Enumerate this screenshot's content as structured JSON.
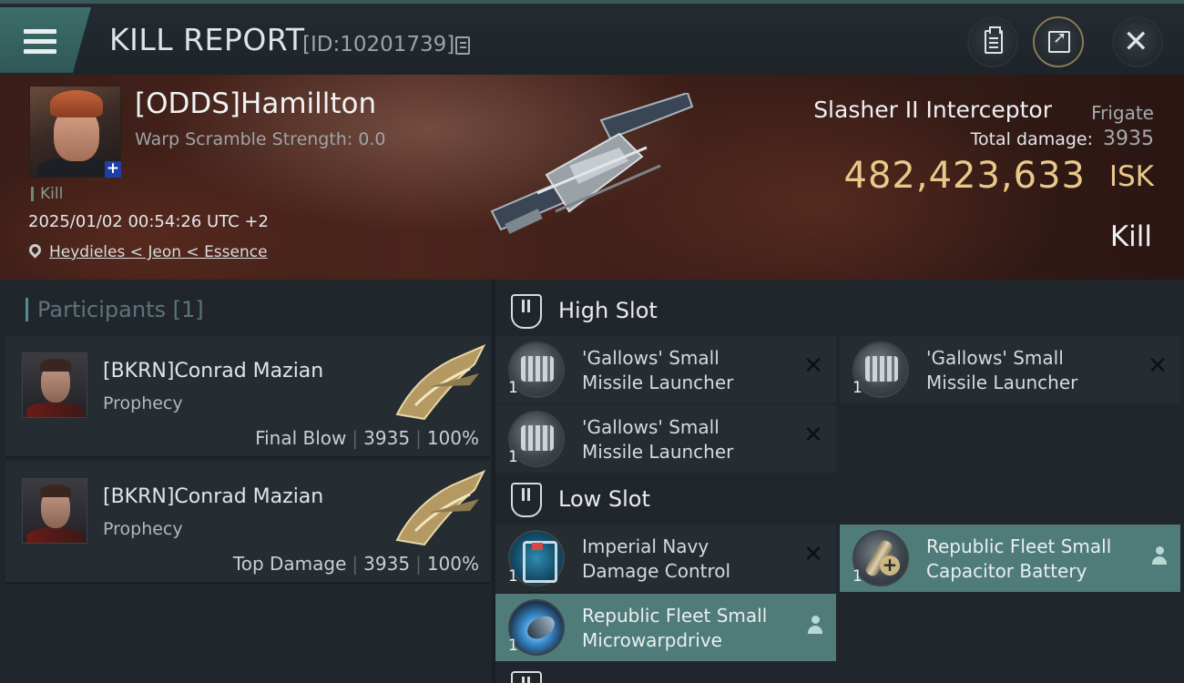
{
  "header": {
    "title": "KILL REPORT",
    "report_id": "[ID:10201739]"
  },
  "victim": {
    "name": "[ODDS]Hamillton",
    "scramble": "Warp Scramble Strength: 0.0",
    "tag": "Kill",
    "datetime": "2025/01/02 00:54:26 UTC +2",
    "location": "Heydieles < Jeon < Essence",
    "ship_name": "Slasher II Interceptor",
    "ship_class": "Frigate",
    "damage_label": "Total damage:",
    "damage_value": "3935",
    "isk_value": "482,423,633",
    "isk_unit": "ISK",
    "outcome": "Kill"
  },
  "participants": {
    "heading": "Participants",
    "count": "[1]",
    "rows": [
      {
        "name": "[BKRN]Conrad Mazian",
        "ship": "Prophecy",
        "role": "Final Blow",
        "damage": "3935",
        "percent": "100%"
      },
      {
        "name": "[BKRN]Conrad Mazian",
        "ship": "Prophecy",
        "role": "Top Damage",
        "damage": "3935",
        "percent": "100%"
      }
    ]
  },
  "fitting": {
    "high_slot": "High Slot",
    "low_slot": "Low Slot",
    "high": [
      {
        "line1": "'Gallows' Small",
        "line2": "Missile Launcher",
        "qty": "1",
        "state": "destroyed"
      },
      {
        "line1": "'Gallows' Small",
        "line2": "Missile Launcher",
        "qty": "1",
        "state": "destroyed"
      },
      {
        "line1": "'Gallows' Small",
        "line2": "Missile Launcher",
        "qty": "1",
        "state": "destroyed"
      }
    ],
    "low": [
      {
        "line1": "Imperial Navy",
        "line2": "Damage Control",
        "qty": "1",
        "state": "destroyed"
      },
      {
        "line1": "Republic Fleet Small",
        "line2": "Capacitor Battery",
        "qty": "1",
        "state": "dropped"
      },
      {
        "line1": "Republic Fleet Small",
        "line2": "Microwarpdrive",
        "qty": "1",
        "state": "dropped"
      }
    ]
  },
  "colors": {
    "isk": "#e9c98a",
    "fitted_module": "#4f7c78",
    "accent": "#4f8f95"
  }
}
